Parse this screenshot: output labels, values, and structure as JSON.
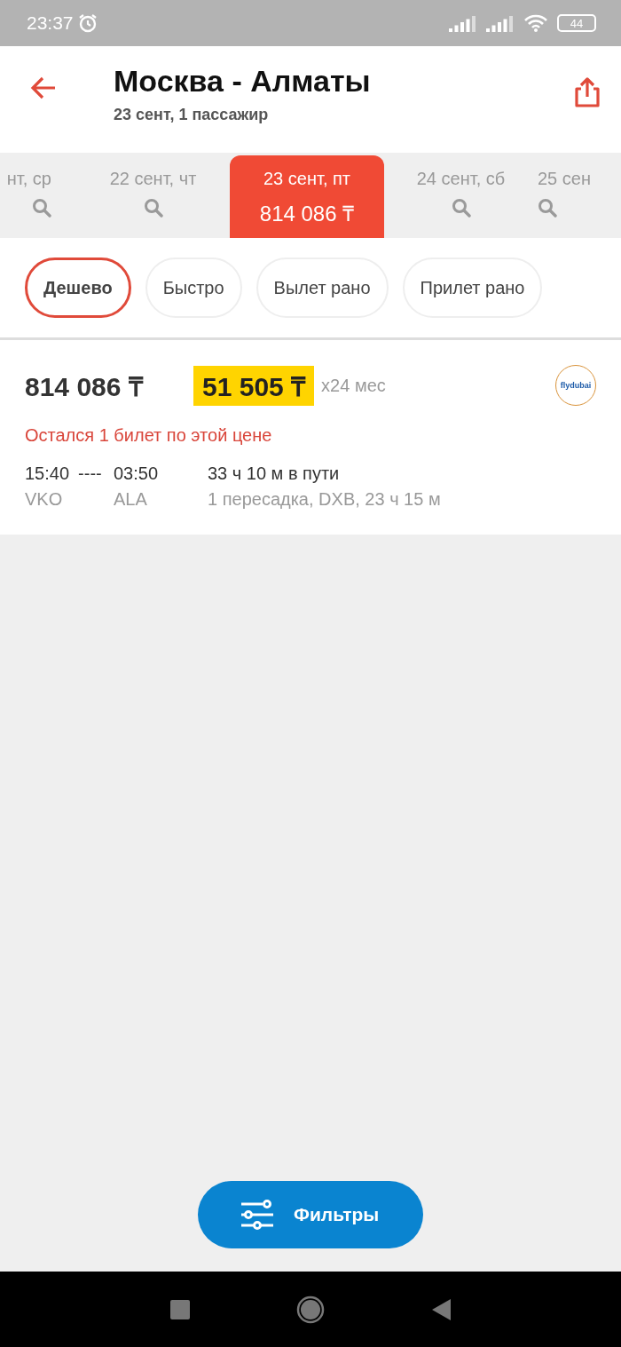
{
  "status_bar": {
    "time": "23:37",
    "battery": "44"
  },
  "header": {
    "title": "Москва - Алматы",
    "subtitle": "23 сент, 1 пассажир"
  },
  "dates": [
    {
      "label": "нт, ср",
      "selected": false
    },
    {
      "label": "22 сент, чт",
      "selected": false
    },
    {
      "label": "23 сент, пт",
      "price": "814 086 ₸",
      "selected": true
    },
    {
      "label": "24 сент, сб",
      "selected": false
    },
    {
      "label": "25 сен",
      "selected": false
    }
  ],
  "sort_chips": [
    {
      "label": "Дешево",
      "selected": true
    },
    {
      "label": "Быстро",
      "selected": false
    },
    {
      "label": "Вылет рано",
      "selected": false
    },
    {
      "label": "Прилет рано",
      "selected": false
    }
  ],
  "offers": [
    {
      "price": "814 086 ₸",
      "installment": "51 505 ₸",
      "installment_term": "x24 мес",
      "airline_logo": "flydubai",
      "warning": "Остался 1 билет по этой цене",
      "depart_time": "15:40",
      "separator": "----",
      "arrive_time": "03:50",
      "depart_airport": "VKO",
      "arrive_airport": "ALA",
      "duration": "33 ч 10 м в пути",
      "stops": "1 пересадка, DXB, 23 ч 15 м"
    }
  ],
  "filters_button": {
    "label": "Фильтры"
  }
}
